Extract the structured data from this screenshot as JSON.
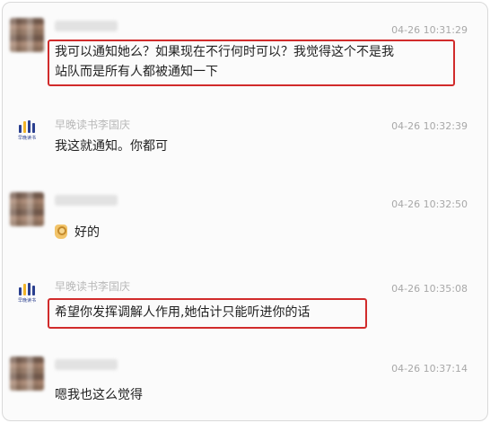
{
  "messages": [
    {
      "sender": "",
      "avatar": "blurred-avatar",
      "time": "04-26 10:31:29",
      "text_lines": [
        "我可以通知她么？如果现在不行何时可以？我觉得这个不是我",
        "站队而是所有人都被通知一下"
      ],
      "highlighted": true
    },
    {
      "sender": "早晚读书李国庆",
      "avatar": "book-logo-icon",
      "avatar_text": "早晚读书",
      "time": "04-26 10:32:39",
      "text_lines": [
        "我这就通知。你都可"
      ],
      "highlighted": false
    },
    {
      "sender": "",
      "avatar": "blurred-avatar",
      "time": "04-26 10:32:50",
      "emoji": "ok-hand-emoji",
      "text_lines": [
        "好的"
      ],
      "highlighted": false
    },
    {
      "sender": "早晚读书李国庆",
      "avatar": "book-logo-icon",
      "avatar_text": "早晚读书",
      "time": "04-26 10:35:08",
      "text_lines": [
        "希望你发挥调解人作用,她估计只能听进你的话"
      ],
      "highlighted": true
    },
    {
      "sender": "",
      "avatar": "blurred-avatar",
      "time": "04-26 10:37:14",
      "text_lines": [
        "嗯我也这么觉得"
      ],
      "highlighted": false
    }
  ],
  "colors": {
    "highlight_border": "#d12b2b",
    "timestamp": "#a8a8a8",
    "sender_name": "#b9b9b9",
    "message_text": "#1f1f1f",
    "logo_blue": "#2a3f8f",
    "logo_yellow": "#f0b429"
  }
}
